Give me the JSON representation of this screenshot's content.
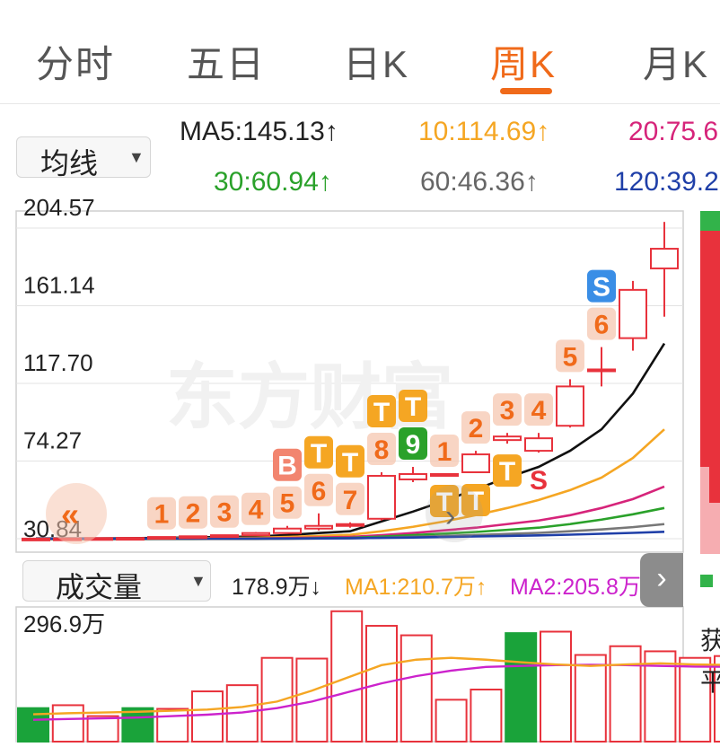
{
  "tabs": [
    {
      "label": "分时",
      "active": false
    },
    {
      "label": "五日",
      "active": false
    },
    {
      "label": "日K",
      "active": false
    },
    {
      "label": "周K",
      "active": true
    },
    {
      "label": "月K",
      "active": false
    }
  ],
  "ma_selector": {
    "label": "均线"
  },
  "ma_values": [
    {
      "text": "MA5:145.13↑",
      "color": "#222222"
    },
    {
      "text": "10:114.69↑",
      "color": "#f5a623"
    },
    {
      "text": "20:75.6",
      "color": "#d6247a"
    },
    {
      "text": "30:60.94↑",
      "color": "#2aa12a"
    },
    {
      "text": "60:46.36↑",
      "color": "#666666"
    },
    {
      "text": "120:39.2",
      "color": "#1f3fa8"
    }
  ],
  "volume_selector": {
    "label": "成交量"
  },
  "volume_values": [
    {
      "text": "178.9万↓",
      "color": "#222222"
    },
    {
      "text": "MA1:210.7万↑",
      "color": "#f5a623"
    },
    {
      "text": "MA2:205.8万↑",
      "color": "#cc22cc"
    }
  ],
  "watermark": "东方财富",
  "side_labels": [
    "获",
    "平"
  ],
  "colors": {
    "up": "#e8323c",
    "down": "#1aa33a",
    "accent": "#f06a1a",
    "signal": "#f5a623"
  },
  "chart_data": {
    "type": "candlestick",
    "y_ticks": [
      "204.57",
      "161.14",
      "117.70",
      "74.27",
      "30.84"
    ],
    "ylim": [
      30.84,
      204.57
    ],
    "candles": [
      {
        "open": 30.8,
        "high": 31.0,
        "low": 30.6,
        "close": 30.9
      },
      {
        "open": 30.9,
        "high": 31.1,
        "low": 30.7,
        "close": 31.0
      },
      {
        "open": 31.0,
        "high": 31.3,
        "low": 30.8,
        "close": 31.2
      },
      {
        "open": 31.2,
        "high": 31.5,
        "low": 31.0,
        "close": 31.3
      },
      {
        "open": 31.3,
        "high": 32.0,
        "low": 31.1,
        "close": 31.8
      },
      {
        "open": 31.8,
        "high": 32.5,
        "low": 31.5,
        "close": 32.2
      },
      {
        "open": 32.2,
        "high": 33.0,
        "low": 32.0,
        "close": 32.8
      },
      {
        "open": 32.8,
        "high": 34.5,
        "low": 32.5,
        "close": 34.0
      },
      {
        "open": 34.0,
        "high": 38.0,
        "low": 33.8,
        "close": 36.5
      },
      {
        "open": 36.5,
        "high": 45.0,
        "low": 35.5,
        "close": 38.0
      },
      {
        "open": 38.0,
        "high": 40.0,
        "low": 37.0,
        "close": 39.0
      },
      {
        "open": 42.0,
        "high": 68.0,
        "low": 41.0,
        "close": 66.0
      },
      {
        "open": 64.0,
        "high": 71.0,
        "low": 62.5,
        "close": 67.0
      },
      {
        "open": 67.0,
        "high": 67.0,
        "low": 67.0,
        "close": 67.0
      },
      {
        "open": 68.0,
        "high": 80.0,
        "low": 67.5,
        "close": 78.0
      },
      {
        "open": 86.0,
        "high": 90.0,
        "low": 84.0,
        "close": 88.0
      },
      {
        "open": 80.0,
        "high": 90.0,
        "low": 79.0,
        "close": 87.0
      },
      {
        "open": 94.0,
        "high": 120.0,
        "low": 93.0,
        "close": 116.0
      },
      {
        "open": 125.0,
        "high": 138.0,
        "low": 116.0,
        "close": 125.5
      },
      {
        "open": 143.0,
        "high": 175.0,
        "low": 136.0,
        "close": 170.0
      },
      {
        "open": 182.0,
        "high": 208.0,
        "low": 155.0,
        "close": 193.0
      }
    ],
    "ma_lines": [
      {
        "name": "MA5",
        "color": "#111111",
        "values": [
          31.0,
          31.0,
          31.0,
          31.1,
          31.3,
          31.5,
          31.8,
          32.1,
          32.9,
          34.0,
          35.0,
          40.5,
          46.0,
          52.0,
          58.5,
          65.0,
          71.0,
          80.0,
          92.0,
          112.0,
          140.0
        ]
      },
      {
        "name": "MA10",
        "color": "#f5a623",
        "values": [
          30.8,
          30.8,
          30.9,
          30.9,
          31.0,
          31.1,
          31.2,
          31.4,
          31.8,
          32.4,
          33.0,
          35.0,
          37.5,
          40.5,
          44.0,
          48.0,
          52.5,
          58.0,
          65.0,
          76.0,
          92.0
        ]
      },
      {
        "name": "MA20",
        "color": "#d6247a",
        "values": [
          30.6,
          30.6,
          30.7,
          30.7,
          30.8,
          30.8,
          30.9,
          31.0,
          31.2,
          31.5,
          31.8,
          32.8,
          34.0,
          35.5,
          37.0,
          39.0,
          41.0,
          44.0,
          48.0,
          53.0,
          60.0
        ]
      },
      {
        "name": "MA30",
        "color": "#2aa12a",
        "values": [
          30.6,
          30.6,
          30.6,
          30.6,
          30.7,
          30.7,
          30.8,
          30.8,
          30.9,
          31.1,
          31.3,
          32.0,
          32.8,
          33.7,
          34.6,
          35.8,
          37.0,
          39.0,
          41.5,
          44.5,
          48.0
        ]
      },
      {
        "name": "MA60",
        "color": "#777777",
        "values": [
          30.7,
          30.7,
          30.7,
          30.7,
          30.7,
          30.7,
          30.7,
          30.7,
          30.8,
          30.9,
          31.0,
          31.4,
          31.9,
          32.4,
          32.9,
          33.5,
          34.1,
          35.0,
          36.0,
          37.3,
          39.0
        ]
      },
      {
        "name": "MA120",
        "color": "#1f3fa8",
        "values": [
          30.9,
          30.9,
          30.9,
          30.9,
          30.9,
          30.9,
          30.9,
          30.9,
          30.9,
          31.0,
          31.1,
          31.3,
          31.5,
          31.8,
          32.1,
          32.4,
          32.7,
          33.1,
          33.6,
          34.1,
          34.7
        ]
      }
    ],
    "markers": [
      {
        "index": 4,
        "label": "1",
        "kind": "num",
        "at": "high"
      },
      {
        "index": 5,
        "label": "2",
        "kind": "num",
        "at": "high"
      },
      {
        "index": 6,
        "label": "3",
        "kind": "num",
        "at": "high"
      },
      {
        "index": 7,
        "label": "4",
        "kind": "num",
        "at": "high"
      },
      {
        "index": 8,
        "label": "5",
        "kind": "num",
        "at": "high"
      },
      {
        "index": 8,
        "label": "B",
        "kind": "buy",
        "at": "high"
      },
      {
        "index": 9,
        "label": "6",
        "kind": "num",
        "at": "high"
      },
      {
        "index": 9,
        "label": "T",
        "kind": "t",
        "at": "high"
      },
      {
        "index": 10,
        "label": "7",
        "kind": "num",
        "at": "high"
      },
      {
        "index": 10,
        "label": "T",
        "kind": "t",
        "at": "high"
      },
      {
        "index": 11,
        "label": "8",
        "kind": "num",
        "at": "high"
      },
      {
        "index": 11,
        "label": "T",
        "kind": "t",
        "at": "high"
      },
      {
        "index": 12,
        "label": "9",
        "kind": "nine",
        "at": "high"
      },
      {
        "index": 12,
        "label": "T",
        "kind": "t",
        "at": "high"
      },
      {
        "index": 13,
        "label": "1",
        "kind": "num",
        "at": "high"
      },
      {
        "index": 14,
        "label": "2",
        "kind": "num",
        "at": "high"
      },
      {
        "index": 15,
        "label": "3",
        "kind": "num",
        "at": "high"
      },
      {
        "index": 16,
        "label": "4",
        "kind": "num",
        "at": "high"
      },
      {
        "index": 17,
        "label": "5",
        "kind": "num",
        "at": "high"
      },
      {
        "index": 18,
        "label": "6",
        "kind": "num",
        "at": "high"
      },
      {
        "index": 18,
        "label": "S",
        "kind": "sell",
        "at": "high"
      },
      {
        "index": 13,
        "label": "T",
        "kind": "t",
        "at": "low"
      },
      {
        "index": 14,
        "label": "T",
        "kind": "t",
        "at": "low"
      },
      {
        "index": 15,
        "label": "T",
        "kind": "t",
        "at": "low"
      },
      {
        "index": 16,
        "label": "S",
        "kind": "s",
        "at": "low"
      }
    ],
    "volume": {
      "label_top": "296.9万",
      "max": 296.9,
      "ma1": [
        75,
        78,
        80,
        82,
        85,
        88,
        95,
        110,
        140,
        175,
        210,
        225,
        230,
        225,
        218,
        212,
        208,
        212,
        215,
        212,
        210.7
      ],
      "ma2": [
        60,
        62,
        64,
        66,
        70,
        74,
        80,
        92,
        110,
        135,
        160,
        180,
        195,
        205,
        208,
        210,
        211,
        210,
        208,
        206,
        205.8
      ],
      "bars": [
        {
          "value": 92,
          "up": false
        },
        {
          "value": 100,
          "up": true
        },
        {
          "value": 70,
          "up": true
        },
        {
          "value": 92,
          "up": false
        },
        {
          "value": 90,
          "up": true
        },
        {
          "value": 138,
          "up": true
        },
        {
          "value": 155,
          "up": true
        },
        {
          "value": 230,
          "up": true
        },
        {
          "value": 228,
          "up": true
        },
        {
          "value": 358,
          "up": true
        },
        {
          "value": 318,
          "up": true
        },
        {
          "value": 292,
          "up": true
        },
        {
          "value": 115,
          "up": true
        },
        {
          "value": 143,
          "up": true
        },
        {
          "value": 298,
          "up": false
        },
        {
          "value": 302,
          "up": true
        },
        {
          "value": 238,
          "up": true
        },
        {
          "value": 262,
          "up": true
        },
        {
          "value": 248,
          "up": true
        },
        {
          "value": 230,
          "up": true
        },
        {
          "value": 235,
          "up": true
        }
      ]
    }
  }
}
